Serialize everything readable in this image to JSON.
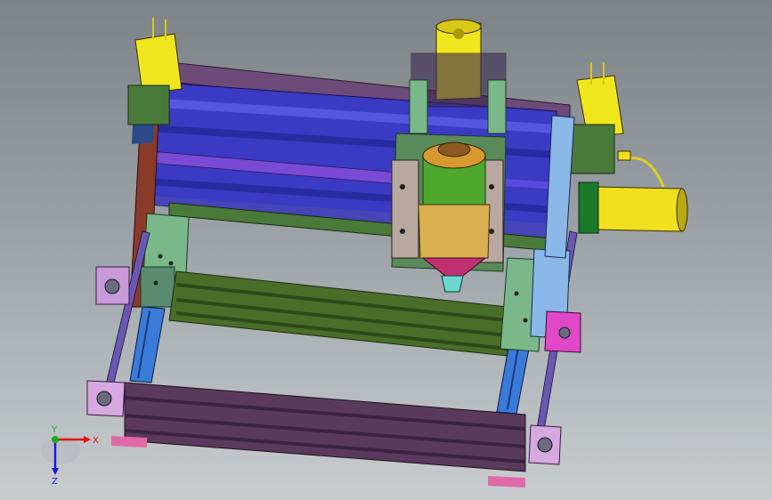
{
  "viewport": {
    "background_top": "#7d8287",
    "background_bottom": "#c9cdd0"
  },
  "model": {
    "description_name": "cnc-router-assembly",
    "colors": {
      "frame_purple": "#5a3c6e",
      "gantry_blue": "#3c3cc8",
      "rail_green": "#4a6e2a",
      "motor_yellow": "#f0e61e",
      "spindle_green": "#4ea82e",
      "bracket_pink": "#e066c8",
      "bracket_lightgreen": "#7ab88a",
      "plate_brown": "#8a3a28",
      "linear_guide_blue": "#3a7ad8",
      "collet_cyan": "#6ad8d0",
      "spindle_tan": "#d8b050",
      "spindle_magenta": "#c03070"
    }
  },
  "triad": {
    "x_label": "X",
    "y_label": "Y",
    "z_label": "Z",
    "x_color": "#e01010",
    "y_color": "#18b018",
    "z_color": "#1818e0"
  }
}
